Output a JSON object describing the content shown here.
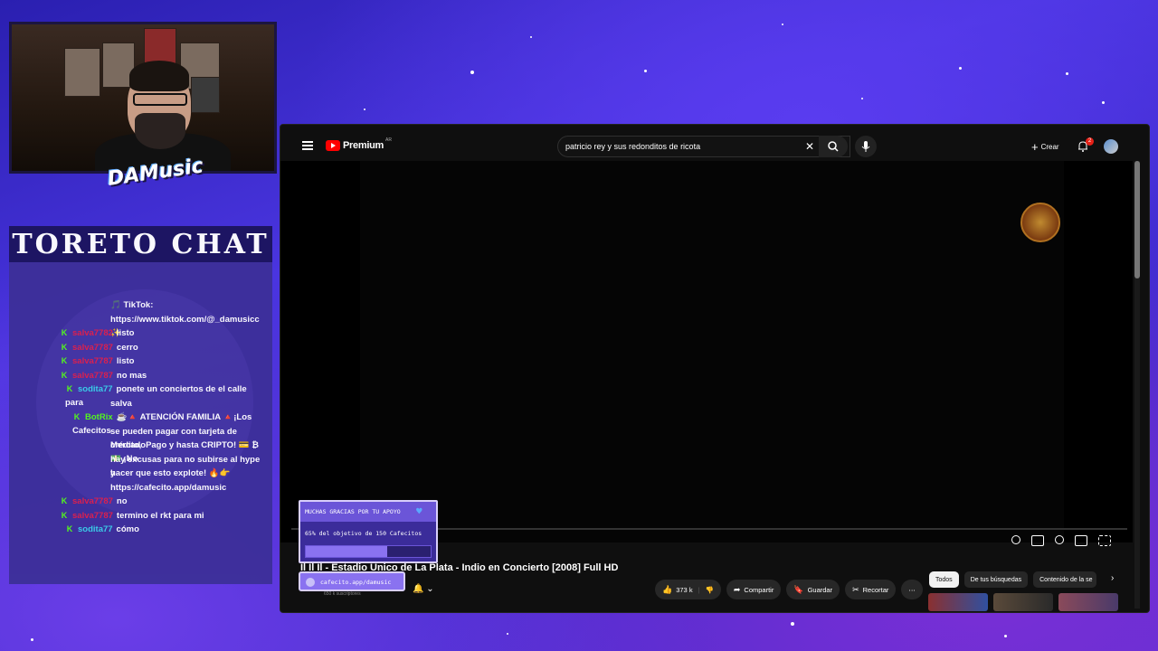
{
  "chat": {
    "title": "TORETO CHAT",
    "messages": [
      {
        "user": "",
        "text": "🎵 TikTok:"
      },
      {
        "user": "",
        "text": "https://www.tiktok.com/@_damusicc ✨"
      },
      {
        "user": "salva7782",
        "text": "listo"
      },
      {
        "user": "salva7787",
        "text": "cerro"
      },
      {
        "user": "salva7787",
        "text": "listo"
      },
      {
        "user": "salva7787",
        "text": "no mas"
      },
      {
        "user": "sodita77",
        "text": "ponete un conciertos de el calle para"
      },
      {
        "user": "",
        "text": "salva"
      },
      {
        "user": "BotRix",
        "text": "☕🔺 ATENCIÓN FAMILIA 🔺¡Los Cafecitos"
      },
      {
        "user": "",
        "text": "se pueden pagar con tarjeta de crédito,"
      },
      {
        "user": "",
        "text": "MercadoPago y hasta CRIPTO! 💳 ₿ 💵 ¡No"
      },
      {
        "user": "",
        "text": "hay excusas para no subirse al hype y"
      },
      {
        "user": "",
        "text": "hacer que esto explote! 🔥👉"
      },
      {
        "user": "",
        "text": "https://cafecito.app/damusic"
      },
      {
        "user": "salva7787",
        "text": "no"
      },
      {
        "user": "salva7787",
        "text": "termino el rkt para mi"
      },
      {
        "user": "sodita77",
        "text": "cómo"
      }
    ]
  },
  "youtube": {
    "logo_text": "Premium",
    "country": "AR",
    "search_value": "patricio rey y sus redonditos de ricota",
    "create_label": "Crear",
    "notifications_count": "2",
    "video_title": "Il Il Il - Estadio Único de La Plata - Indio en Concierto [2008] Full HD",
    "subscribers": "650 k suscriptores",
    "likes": "373 k",
    "share_label": "Compartir",
    "save_label": "Guardar",
    "clip_label": "Recortar",
    "chips": [
      "Todos",
      "De tus búsquedas",
      "Contenido de la se"
    ]
  },
  "cafecito": {
    "header": "MUCHAS GRACIAS POR TU APOYO",
    "goal_text": "65% del objetivo de 150 Cafecitos",
    "progress": 0.65,
    "link": "cafecito.app/damusic"
  },
  "colors": {
    "user_red": "#e0204a",
    "user_cyan": "#3ad0e8",
    "user_green": "#53fc18",
    "yt_red": "#ff0000"
  }
}
